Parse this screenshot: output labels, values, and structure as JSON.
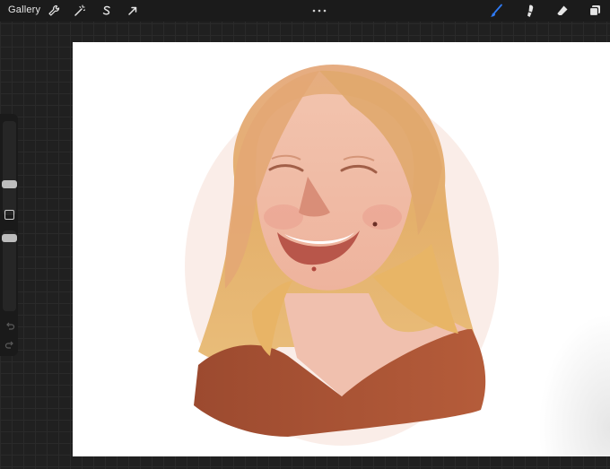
{
  "toolbar": {
    "gallery_label": "Gallery",
    "actions_icon": "wrench-icon",
    "adjustments_icon": "magic-wand-icon",
    "selection_icon": "selection-s-icon",
    "transform_icon": "arrow-cursor-icon",
    "more_icon": "ellipsis-icon",
    "brush_icon": "brush-icon",
    "smudge_icon": "smudge-icon",
    "eraser_icon": "eraser-icon",
    "layers_icon": "layers-icon",
    "active_tool": "brush",
    "accent_color": "#2f7bf6"
  },
  "sidebar": {
    "brush_size_level": 0.4,
    "opacity_level": 0.45,
    "modify_icon": "square-icon",
    "undo_icon": "undo-icon",
    "redo_icon": "redo-icon"
  },
  "canvas": {
    "background": "#ffffff",
    "artwork": "painted-portrait",
    "colors": {
      "hair": "#e1ad6b",
      "skin": "#efb39d",
      "shirt": "#a44e30",
      "lips": "#c96a5a"
    }
  }
}
